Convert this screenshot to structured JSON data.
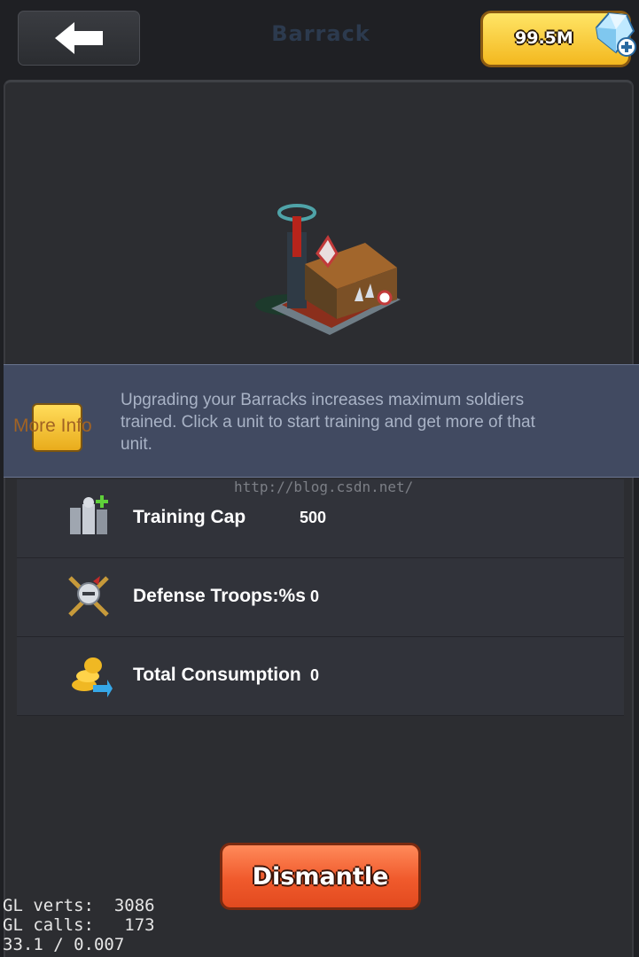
{
  "header": {
    "title": "Barrack",
    "gems": "99.5M"
  },
  "info": {
    "more_info_label": "More Info",
    "description": "Upgrading your Barracks increases maximum soldiers trained. Click a unit to start training and get more of that unit."
  },
  "watermark": "http://blog.csdn.net/",
  "stats": [
    {
      "label": "Training Cap",
      "value": "500",
      "icon": "training-cap-icon"
    },
    {
      "label": "Defense Troops:%s",
      "value": "0",
      "icon": "defense-troops-icon"
    },
    {
      "label": "Total Consumption",
      "value": "0",
      "icon": "total-consumption-icon"
    }
  ],
  "actions": {
    "dismantle_label": "Dismantle"
  },
  "debug": {
    "line1": "GL verts:  3086",
    "line2": "GL calls:   173",
    "line3": "33.1 / 0.007"
  },
  "colors": {
    "background": "#1f2024",
    "panel": "#2c2d31",
    "info_band": "#414a61",
    "gem_button": "#f3b81f",
    "dismantle_button": "#f05a2c"
  }
}
